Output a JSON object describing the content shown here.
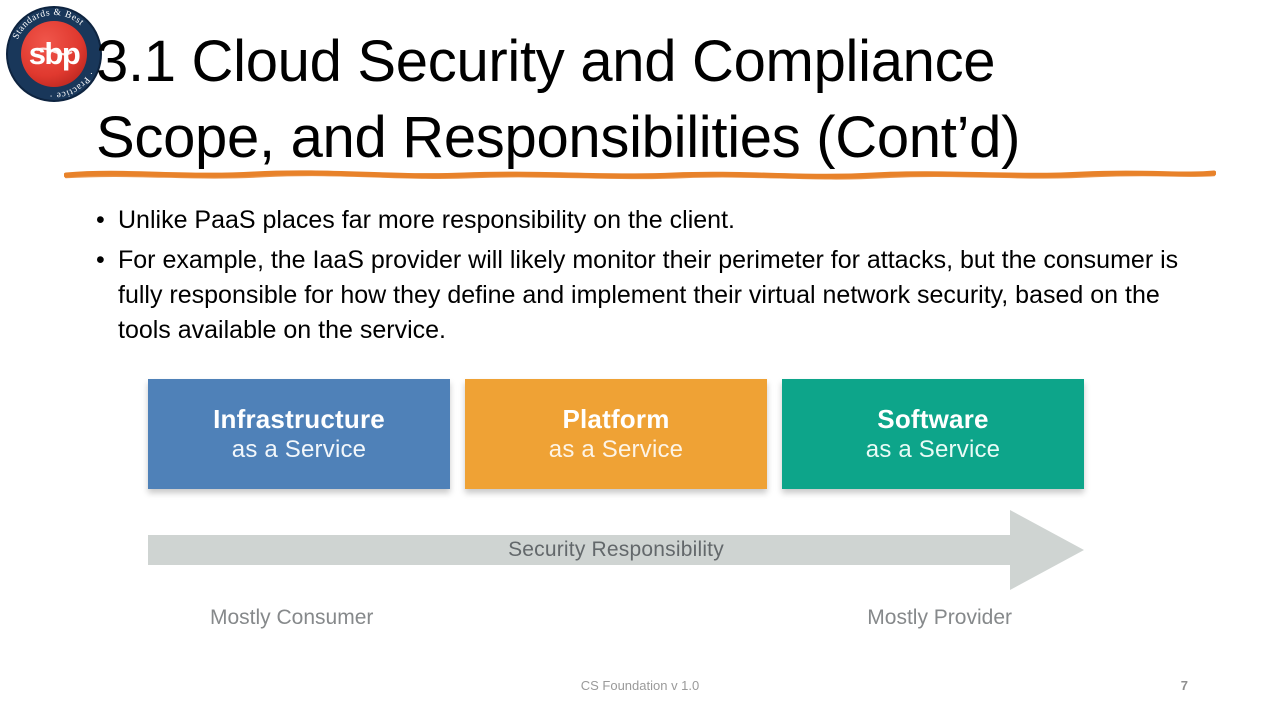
{
  "slide": {
    "title_lines": [
      "3.1 Cloud Security and Compliance",
      "Scope, and Responsibilities (Cont’d)"
    ],
    "bullets": [
      "Unlike PaaS places far more responsibility on the client.",
      "For example, the IaaS provider will likely monitor their perimeter for attacks, but the consumer is fully responsible for how they define and implement their virtual network security, based on the tools available on the service."
    ],
    "bullet_marker": "•"
  },
  "logo": {
    "name": "sbp-logo",
    "ring_text": "Standards & Best Practice",
    "monogram": "sbp",
    "ring_color": "#1b3b5f",
    "disc_color": "#e0392f"
  },
  "accent": {
    "title_underline_color": "#e8822a"
  },
  "diagram": {
    "boxes": [
      {
        "title": "Infrastructure",
        "subtitle": "as a Service",
        "color": "#4f81b8",
        "key": "iaas"
      },
      {
        "title": "Platform",
        "subtitle": "as a Service",
        "color": "#efa235",
        "key": "paas"
      },
      {
        "title": "Software",
        "subtitle": "as a Service",
        "color": "#0da58a",
        "key": "saas"
      }
    ],
    "arrow": {
      "label": "Security Responsibility",
      "color": "#cfd4d2",
      "direction": "right"
    },
    "end_labels": {
      "left": "Mostly Consumer",
      "right": "Mostly Provider"
    }
  },
  "footer": {
    "center_text": "CS Foundation  v 1.0",
    "page_number": "7"
  }
}
